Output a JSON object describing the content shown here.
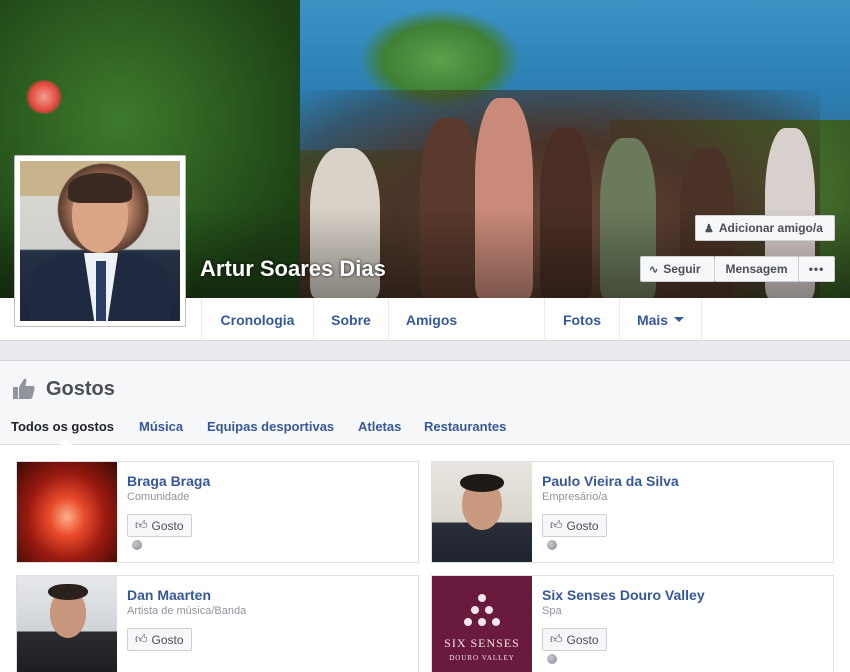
{
  "profile": {
    "name": "Artur Soares Dias"
  },
  "cover_actions": {
    "add_friend": "Adicionar amigo/a",
    "follow": "Seguir",
    "message": "Mensagem",
    "more": "•••"
  },
  "tabs": [
    "Cronologia",
    "Sobre",
    "Amigos",
    "Fotos",
    "Mais"
  ],
  "likes": {
    "title": "Gostos",
    "subtabs": [
      "Todos os gostos",
      "Música",
      "Equipas desportivas",
      "Atletas",
      "Restaurantes"
    ],
    "like_label": "Gosto",
    "items": [
      {
        "name": "Braga Braga",
        "category": "Comunidade"
      },
      {
        "name": "Paulo Vieira da Silva",
        "category": "Empresário/a"
      },
      {
        "name": "Dan Maarten",
        "category": "Artista de música/Banda"
      },
      {
        "name": "Six Senses Douro Valley",
        "category": "Spa"
      }
    ],
    "six_senses_logo_line1": "SIX SENSES",
    "six_senses_logo_line2": "DOURO VALLEY"
  },
  "colors": {
    "link": "#365899",
    "background": "#e9ebee",
    "button_bg": "#f6f7f9"
  }
}
